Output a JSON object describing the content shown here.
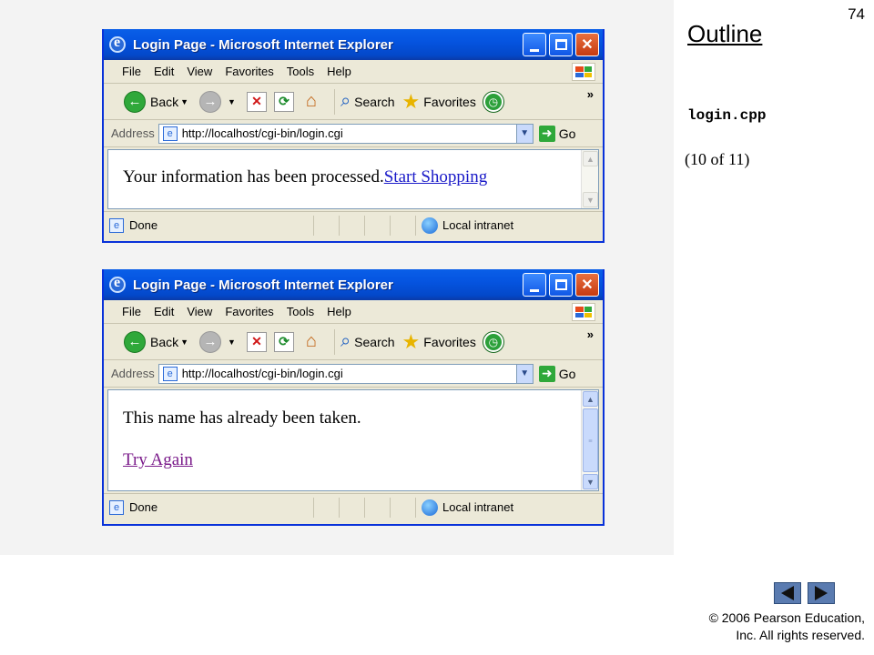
{
  "slide": {
    "page_number": "74",
    "outline_label": "Outline",
    "file_name": "login.cpp",
    "page_of": "(10 of 11)",
    "copyright_line1": "© 2006 Pearson Education,",
    "copyright_line2": "Inc.  All rights reserved."
  },
  "browser": {
    "title": "Login Page - Microsoft Internet Explorer",
    "menu": [
      "File",
      "Edit",
      "View",
      "Favorites",
      "Tools",
      "Help"
    ],
    "back_label": "Back",
    "search_label": "Search",
    "favorites_label": "Favorites",
    "address_label": "Address",
    "go_label": "Go",
    "status_done": "Done",
    "status_zone": "Local intranet"
  },
  "window1": {
    "url": "http://localhost/cgi-bin/login.cgi",
    "message": "Your information has been processed.",
    "link": "Start Shopping"
  },
  "window2": {
    "url": "http://localhost/cgi-bin/login.cgi",
    "message": "This name has already been taken.",
    "link": "Try Again"
  },
  "colors": {
    "title_bar": "#0554e0",
    "link": "#1a1ac8",
    "visited_link": "#7a1a8a",
    "nav_button": "#5a7bb0"
  }
}
